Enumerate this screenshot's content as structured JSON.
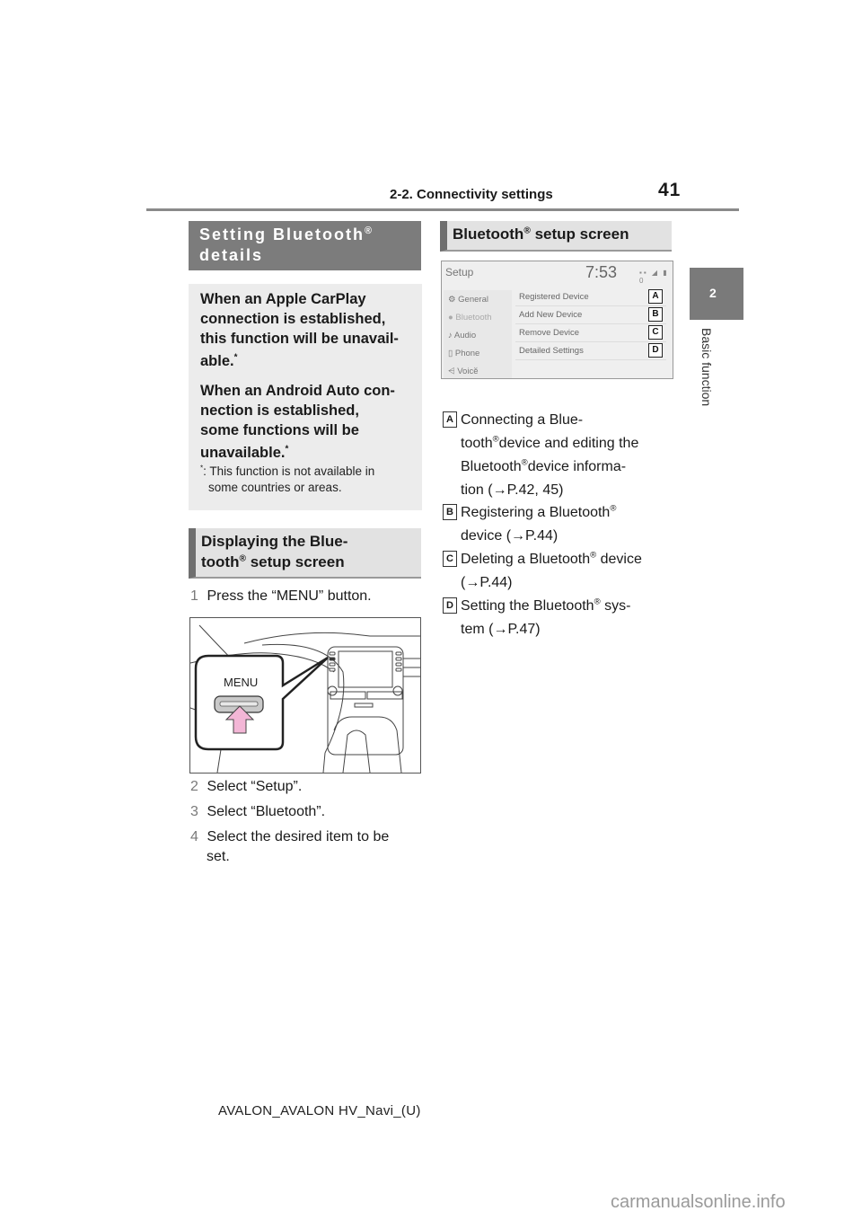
{
  "header": {
    "section": "2-2. Connectivity settings",
    "page_number": "41"
  },
  "side_tab": {
    "chapter_number": "2",
    "chapter_label": "Basic function"
  },
  "left": {
    "heading1": {
      "text": "Setting Bluetooth",
      "reg": "®",
      "line2": "details"
    },
    "note": {
      "para1_a": "When an Apple CarPlay",
      "para1_b": "connection is established,",
      "para1_c": "this function will be unavail-",
      "para1_d": "able.",
      "para2_a": "When an Android Auto con-",
      "para2_b": "nection is established,",
      "para2_c": "some functions will be",
      "para2_d": "unavailable.",
      "asterisk": "*",
      "footnote_a": ": This function is not available in",
      "footnote_b": "some countries or areas."
    },
    "heading2": {
      "line1": "Displaying the Blue-",
      "line2_a": "tooth",
      "reg": "®",
      "line2_b": " setup screen"
    },
    "steps": [
      {
        "num": "1",
        "text": "Press the “MENU” button."
      },
      {
        "num": "2",
        "text": "Select “Setup”."
      },
      {
        "num": "3",
        "text": "Select “Bluetooth”."
      },
      {
        "num": "4",
        "text": "Select the desired item to be",
        "text2": "set."
      }
    ],
    "figure": {
      "callout_label": "MENU"
    }
  },
  "right": {
    "heading": {
      "text": "Bluetooth",
      "reg": "®",
      "text2": " setup screen"
    },
    "screen": {
      "title": "Setup",
      "clock": "7:53",
      "status": "▪▪ ◢ ▮ 0",
      "menu": [
        {
          "icon": "⚙",
          "label": "General"
        },
        {
          "icon": "●",
          "label": "Bluetooth"
        },
        {
          "icon": "♪",
          "label": "Audio"
        },
        {
          "icon": "▯",
          "label": "Phone"
        },
        {
          "icon": "⩤",
          "label": "Voice"
        }
      ],
      "chevron": "⌄",
      "rows": [
        {
          "label": "Registered Device",
          "key": "A"
        },
        {
          "label": "Add New Device",
          "key": "B"
        },
        {
          "label": "Remove Device",
          "key": "C"
        },
        {
          "label": "Detailed Settings",
          "key": "D"
        }
      ]
    },
    "legend": [
      {
        "key": "A",
        "l1": "Connecting a Blue-",
        "l2a": "tooth",
        "l2b": "device and editing the",
        "l3a": "Bluetooth",
        "l3b": "device informa-",
        "l4": "tion (→P.42, 45)"
      },
      {
        "key": "B",
        "l1a": "Registering a Bluetooth",
        "l2": "device (→P.44)"
      },
      {
        "key": "C",
        "l1a": "Deleting a Bluetooth",
        "l1b": " device",
        "l2": "(→P.44)"
      },
      {
        "key": "D",
        "l1a": "Setting the Bluetooth",
        "l1b": " sys-",
        "l2": "tem (→P.47)"
      }
    ],
    "reg": "®"
  },
  "footer": {
    "model": "AVALON_AVALON HV_Navi_(U)"
  },
  "watermark": "carmanualsonline.info"
}
